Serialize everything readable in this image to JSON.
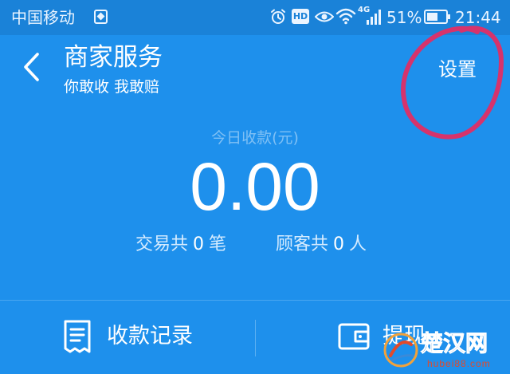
{
  "status_bar": {
    "carrier": "中国移动",
    "hd_badge": "HD",
    "network_type": "4G",
    "battery": "51%",
    "time": "21:44",
    "icons": [
      "carrier-app-icon",
      "alarm-icon",
      "hd-icon",
      "eye-icon",
      "wifi-icon",
      "signal-icon",
      "battery-icon"
    ]
  },
  "header": {
    "back_icon": "chevron-left-icon",
    "title": "商家服务",
    "subtitle": "你敢收 我敢赔",
    "settings_label": "设置"
  },
  "income": {
    "label": "今日收款(元)",
    "amount": "0.00",
    "transactions": {
      "prefix": "交易共",
      "count": "0",
      "unit": "笔"
    },
    "customers": {
      "prefix": "顾客共",
      "count": "0",
      "unit": "人"
    }
  },
  "actions": {
    "records": {
      "icon": "receipt-icon",
      "label": "收款记录"
    },
    "withdraw": {
      "icon": "wallet-icon",
      "label": "提现"
    }
  },
  "watermark": {
    "text": "楚汉网",
    "url": "hubei88.com"
  },
  "colors": {
    "primary": "#1e90ec",
    "status_bar": "#1a82d8",
    "annotation": "#d6336c",
    "muted_label": "#7fc0f5"
  }
}
